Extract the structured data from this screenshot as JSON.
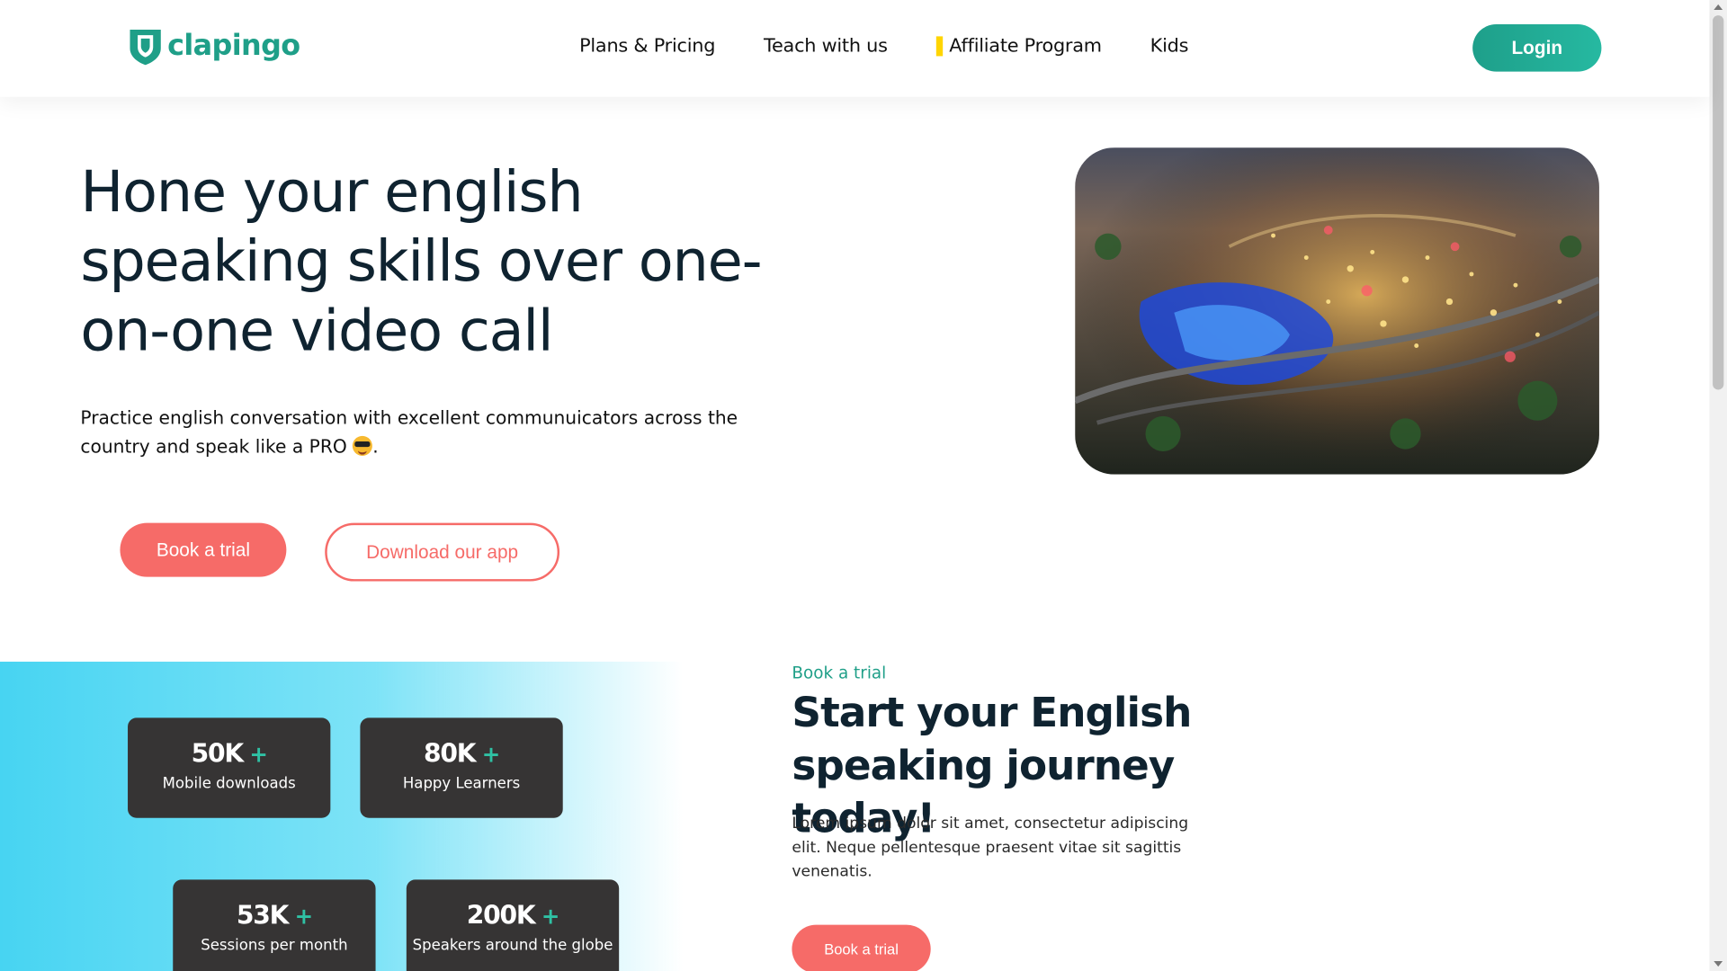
{
  "brand": {
    "name": "clapingo",
    "color": "#1f9f88"
  },
  "nav": {
    "items": [
      "Plans & Pricing",
      "Teach with us",
      "Affiliate Program",
      "Kids"
    ],
    "login_label": "Login"
  },
  "hero": {
    "title": "Hone your english speaking skills over one-on-one video call",
    "subtitle": "Practice english conversation with excellent communuicators across the country and speak like a PRO",
    "subtitle_end": ".",
    "emoji_icon": "sunglasses-emoji-icon",
    "book_trial_label": "Book a trial",
    "download_app_label": "Download our app"
  },
  "stats": [
    {
      "value": "50K",
      "plus": "+",
      "label": "Mobile downloads"
    },
    {
      "value": "80K",
      "plus": "+",
      "label": "Happy Learners"
    },
    {
      "value": "53K",
      "plus": "+",
      "label": "Sessions per month"
    },
    {
      "value": "200K",
      "plus": "+",
      "label": "Speakers around the globe"
    }
  ],
  "trial_section": {
    "eyebrow": "Book a trial",
    "title": "Start your English speaking journey today!",
    "body": "Lorem ipsum dolor sit amet, consectetur adipiscing elit. Neque pellentesque praesent vitae sit sagittis venenatis.",
    "button_label": "Book a trial"
  },
  "colors": {
    "accent": "#f66b68",
    "teal": "#1f9f88",
    "card": "#363434",
    "cyan": "#47d4f2"
  }
}
